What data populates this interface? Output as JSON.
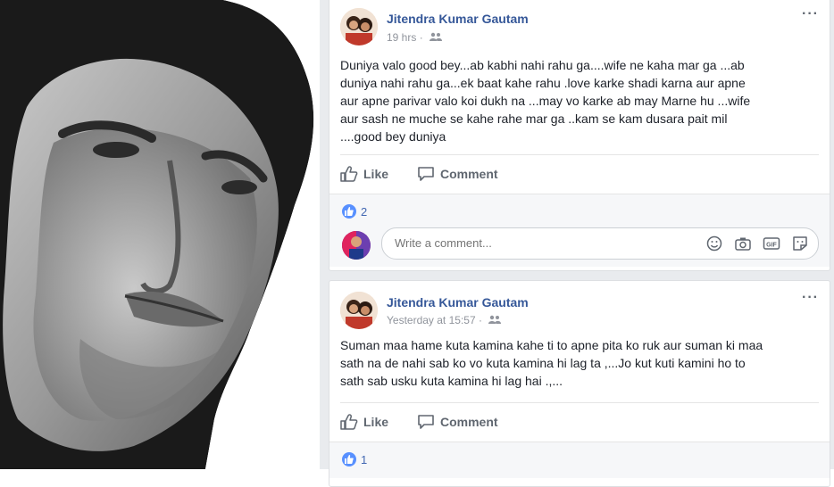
{
  "posts": [
    {
      "author": "Jitendra Kumar Gautam",
      "time": "19 hrs",
      "separator": "·",
      "more": "···",
      "lines": [
        "Duniya valo good bey...ab kabhi nahi rahu ga....wife ne kaha mar ga ...ab",
        "duniya nahi rahu ga...ek baat kahe rahu .love karke shadi karna aur apne",
        "aur apne parivar valo koi dukh na ...may vo karke ab may Marne hu ...wife",
        "aur sash ne muche se kahe rahe mar ga ..kam se kam dusara pait mil",
        "....good bey duniya"
      ],
      "like_label": "Like",
      "comment_label": "Comment",
      "likes": "2",
      "comment_placeholder": "Write a comment..."
    },
    {
      "author": "Jitendra Kumar Gautam",
      "time": "Yesterday at 15:57",
      "separator": "·",
      "more": "···",
      "lines": [
        "Suman maa hame kuta kamina kahe ti to apne pita ko ruk aur suman ki maa",
        "sath na de nahi sab ko vo kuta kamina hi lag ta ,...Jo kut kuti kamini ho to",
        "sath sab usku kuta kamina hi lag hai .,..."
      ],
      "like_label": "Like",
      "comment_label": "Comment",
      "likes": "1"
    }
  ],
  "colors": {
    "author_link": "#365899",
    "feed_bg": "#e9ebee",
    "like_blue": "#5890ff"
  },
  "icons": [
    "audience-friends-icon",
    "more-options-icon",
    "like-thumb-icon",
    "comment-bubble-icon",
    "emoji-icon",
    "camera-icon",
    "gif-icon",
    "sticker-icon"
  ]
}
